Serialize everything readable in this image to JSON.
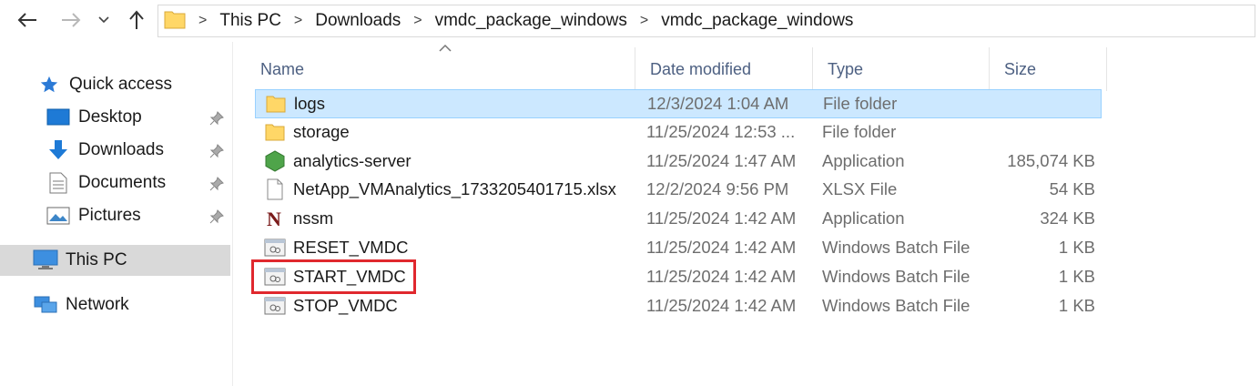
{
  "address_bar": {
    "crumbs": [
      "This PC",
      "Downloads",
      "vmdc_package_windows",
      "vmdc_package_windows"
    ]
  },
  "nav_pane": {
    "quick_access": "Quick access",
    "items": [
      {
        "label": "Desktop",
        "icon": "desktop-icon",
        "pinned": true
      },
      {
        "label": "Downloads",
        "icon": "downloads-icon",
        "pinned": true
      },
      {
        "label": "Documents",
        "icon": "documents-icon",
        "pinned": true
      },
      {
        "label": "Pictures",
        "icon": "pictures-icon",
        "pinned": true
      }
    ],
    "this_pc": "This PC",
    "network": "Network"
  },
  "columns": {
    "name": "Name",
    "date": "Date modified",
    "type": "Type",
    "size": "Size"
  },
  "files": [
    {
      "name": "logs",
      "date": "12/3/2024 1:04 AM",
      "type": "File folder",
      "size": "",
      "icon": "folder-icon",
      "selected": true
    },
    {
      "name": "storage",
      "date": "11/25/2024 12:53 ...",
      "type": "File folder",
      "size": "",
      "icon": "folder-icon"
    },
    {
      "name": "analytics-server",
      "date": "11/25/2024 1:47 AM",
      "type": "Application",
      "size": "185,074 KB",
      "icon": "nodejs-app-icon"
    },
    {
      "name": "NetApp_VMAnalytics_1733205401715.xlsx",
      "date": "12/2/2024 9:56 PM",
      "type": "XLSX File",
      "size": "54 KB",
      "icon": "blank-file-icon"
    },
    {
      "name": "nssm",
      "date": "11/25/2024 1:42 AM",
      "type": "Application",
      "size": "324 KB",
      "icon": "nssm-app-icon"
    },
    {
      "name": "RESET_VMDC",
      "date": "11/25/2024 1:42 AM",
      "type": "Windows Batch File",
      "size": "1 KB",
      "icon": "batch-file-icon"
    },
    {
      "name": "START_VMDC",
      "date": "11/25/2024 1:42 AM",
      "type": "Windows Batch File",
      "size": "1 KB",
      "icon": "batch-file-icon",
      "highlighted": true
    },
    {
      "name": "STOP_VMDC",
      "date": "11/25/2024 1:42 AM",
      "type": "Windows Batch File",
      "size": "1 KB",
      "icon": "batch-file-icon"
    }
  ],
  "colors": {
    "selection_bg": "#cce8ff",
    "selection_border": "#99d1ff",
    "highlight_border": "#e0282e",
    "header_text": "#4d6082",
    "folder_yellow": "#ffd767"
  }
}
